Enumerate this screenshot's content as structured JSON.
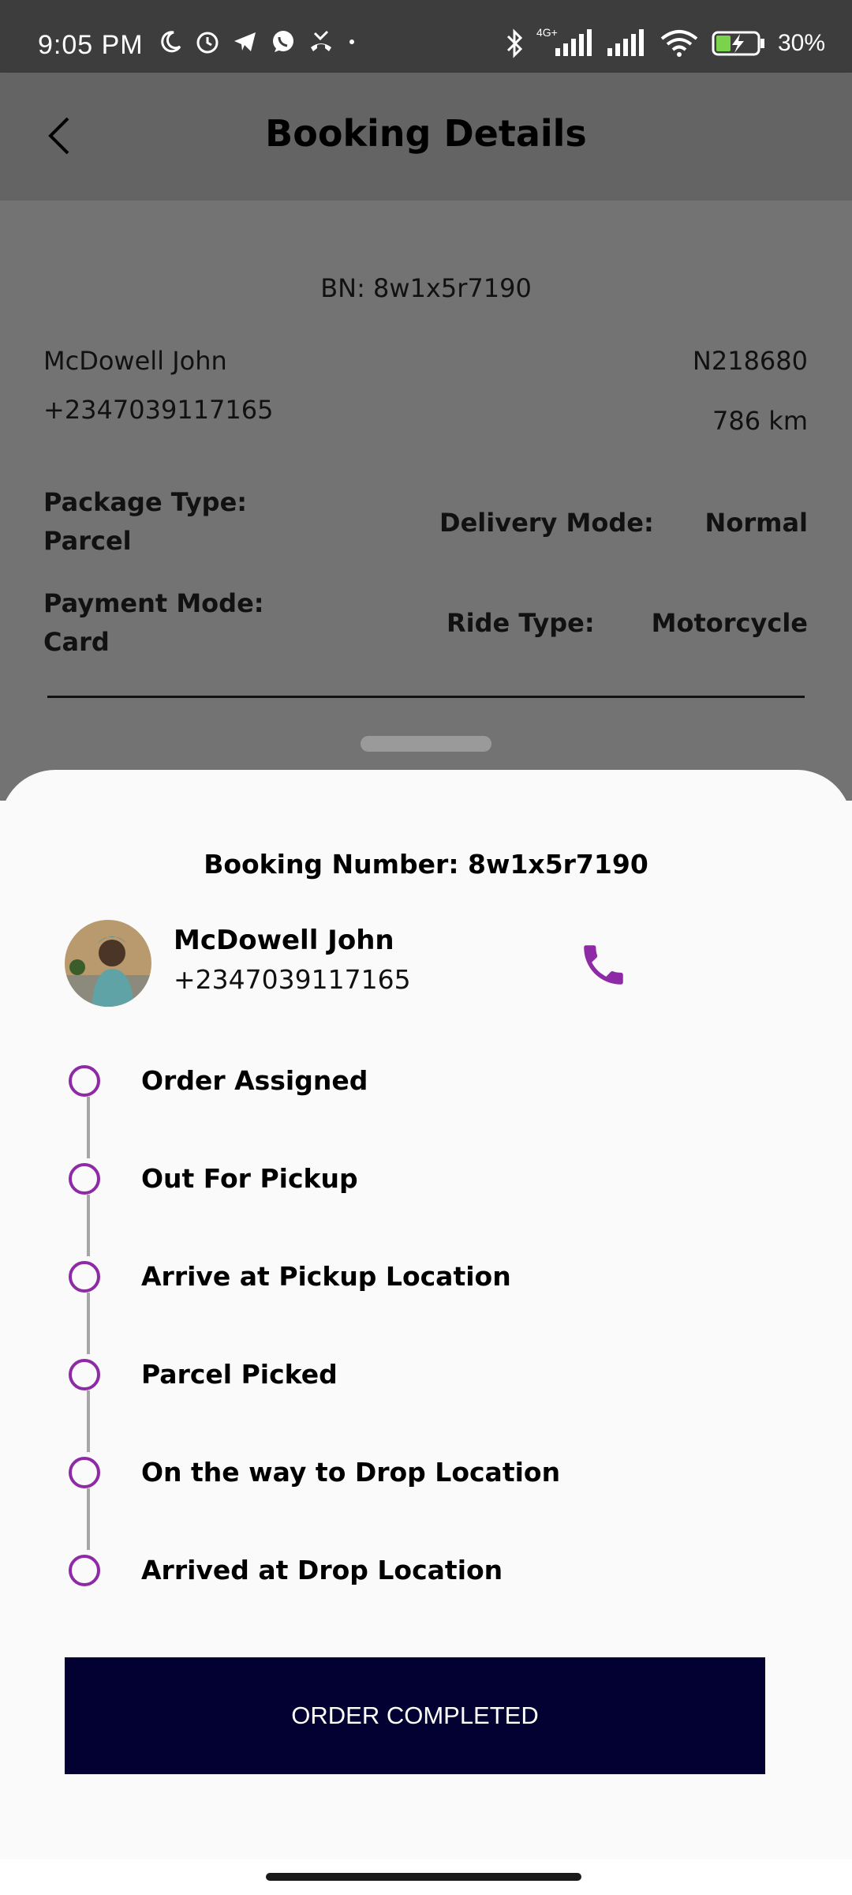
{
  "status_bar": {
    "time": "9:05 PM",
    "battery": "30%",
    "network_label": "4G+",
    "left_icons": [
      "moon-icon",
      "alarm-icon",
      "telegram-icon",
      "whatsapp-icon",
      "missed-call-icon",
      "dot-icon"
    ],
    "right_icons": [
      "bluetooth-icon",
      "signal-icon",
      "signal-icon",
      "wifi-icon",
      "battery-charging-icon"
    ]
  },
  "header": {
    "title": "Booking Details",
    "back_icon": "chevron-left-icon"
  },
  "summary": {
    "booking_number": "BN: 8w1x5r7190",
    "customer_name": "McDowell John",
    "customer_phone": "+2347039117165",
    "order_id": "N218680",
    "distance": "786 km",
    "package_type_label": "Package Type:",
    "package_type_value": "Parcel",
    "delivery_mode_label": "Delivery Mode:",
    "delivery_mode_value": "Normal",
    "payment_mode_label": "Payment Mode:",
    "payment_mode_value": "Card",
    "ride_type_label": "Ride Type:",
    "ride_type_value": "Motorcycle"
  },
  "sheet": {
    "booking_number": "Booking Number: 8w1x5r7190",
    "customer_name": "McDowell John",
    "customer_phone": "+2347039117165",
    "call_icon": "phone-icon",
    "steps": [
      {
        "label": "Order Assigned"
      },
      {
        "label": "Out For Pickup"
      },
      {
        "label": "Arrive at Pickup Location"
      },
      {
        "label": "Parcel Picked"
      },
      {
        "label": "On the way to Drop Location"
      },
      {
        "label": "Arrived at Drop Location"
      }
    ],
    "action_button": "ORDER COMPLETED"
  },
  "colors": {
    "accent_purple": "#8e2aa6",
    "button_navy": "#020131",
    "scrim": "#737373",
    "app_bar": "#646464"
  }
}
